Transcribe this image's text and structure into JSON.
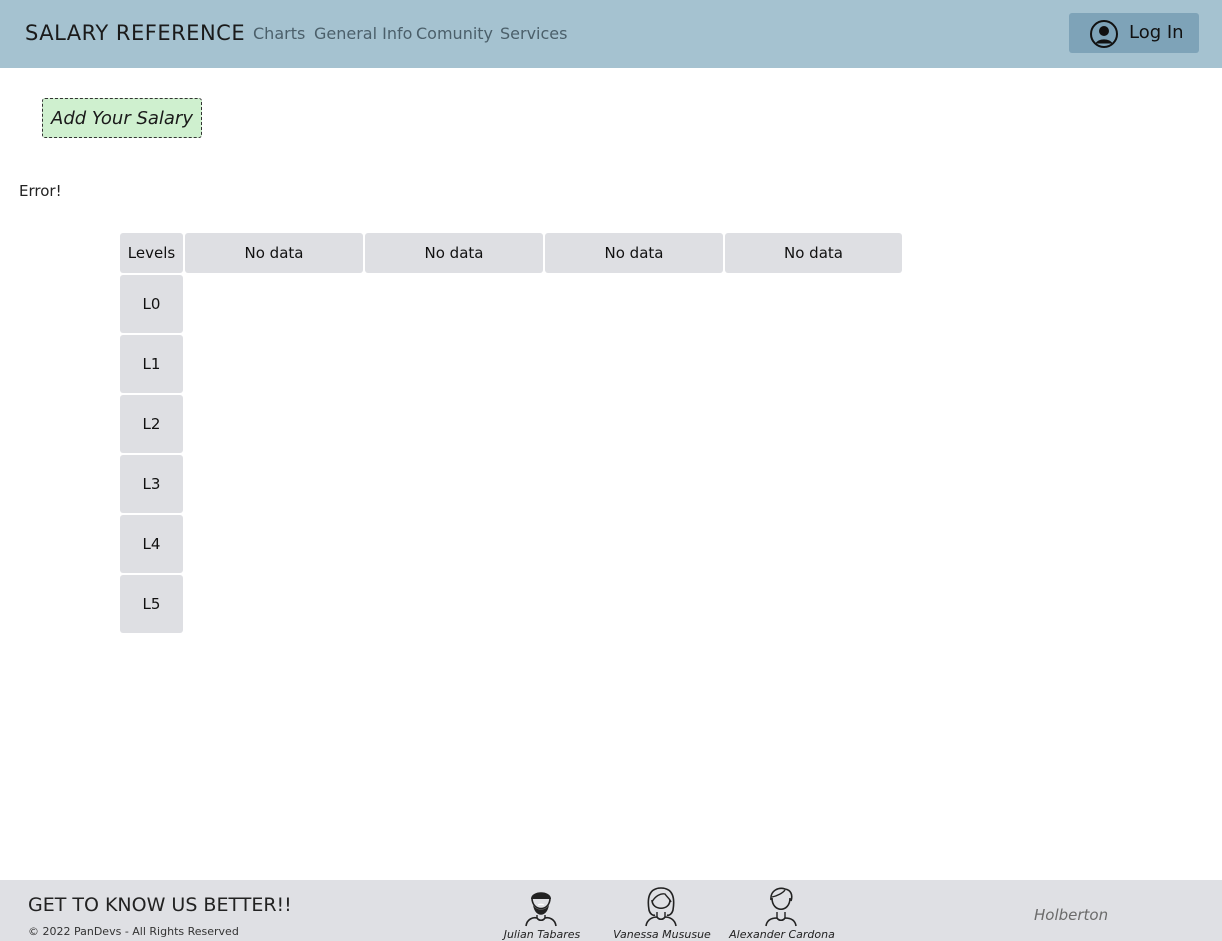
{
  "navbar": {
    "brand": "SALARY REFERENCE",
    "links": [
      "Charts",
      "General Info",
      "Comunity",
      "Services"
    ],
    "login_label": "Log In",
    "login_icon": "user-circle-icon"
  },
  "main": {
    "add_salary_label": "Add Your Salary",
    "error_text": "Error!",
    "table": {
      "header_first": "Levels",
      "columns": [
        "No data",
        "No data",
        "No data",
        "No data"
      ],
      "levels": [
        "L0",
        "L1",
        "L2",
        "L3",
        "L4",
        "L5"
      ]
    }
  },
  "footer": {
    "title": "GET TO KNOW US BETTER!!",
    "copyright": "© 2022 PanDevs - All Rights Reserved",
    "members": [
      {
        "name": "Julian Tabares",
        "icon": "bearded-man-avatar-icon"
      },
      {
        "name": "Vanessa Mususue",
        "icon": "woman-avatar-icon"
      },
      {
        "name": "Alexander Cardona",
        "icon": "man-avatar-icon"
      }
    ],
    "partner": "Holberton"
  },
  "colors": {
    "navbar_bg": "#a5c2d0",
    "login_bg": "#7ea3b8",
    "add_button_bg": "#cff0cf",
    "table_cell_bg": "#dedfe3",
    "footer_bg": "#dfe0e4"
  }
}
